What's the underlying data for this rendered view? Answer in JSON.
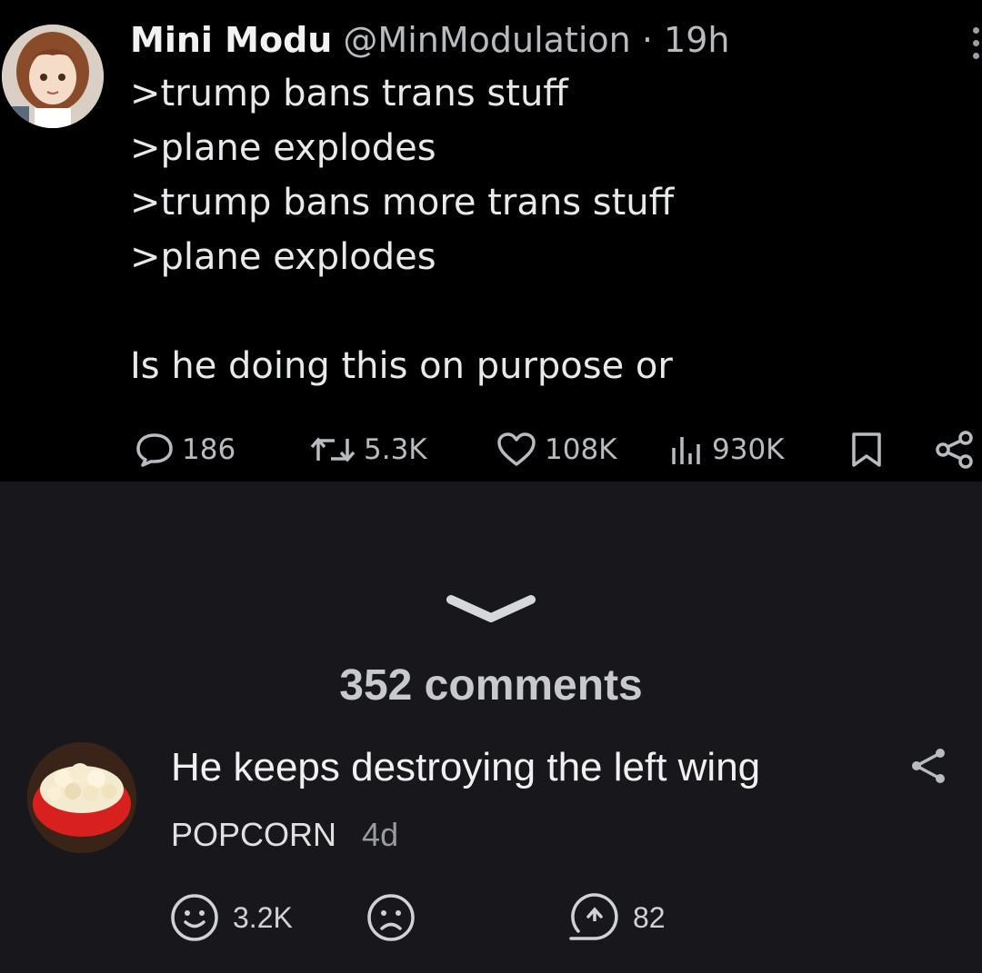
{
  "tweet": {
    "author_name": "Mini Modu",
    "handle": "@MinModulation",
    "separator": "·",
    "time": "19h",
    "lines": [
      ">trump bans trans stuff",
      ">plane explodes",
      ">trump bans more trans stuff",
      ">plane explodes",
      "Is he doing this on purpose or"
    ],
    "stats": {
      "replies": "186",
      "retweets": "5.3K",
      "likes": "108K",
      "views": "930K"
    }
  },
  "comments_header": "352 comments",
  "comment": {
    "text": "He keeps destroying the left wing",
    "username": "POPCORN",
    "age": "4d",
    "likes": "3.2K",
    "replies": "82"
  },
  "icons": {
    "reply": "reply-bubble-icon",
    "retweet": "retweet-icon",
    "like": "heart-icon",
    "views": "views-chart-icon",
    "bookmark": "bookmark-icon",
    "share": "share-icon",
    "more": "more-vertical-icon",
    "expand": "chevron-down-icon",
    "upvote": "smile-face-icon",
    "downvote": "frown-face-icon",
    "reply_comment": "reply-arrow-icon"
  },
  "colors": {
    "tweet_bg": "#000000",
    "page_bg": "#18181c",
    "text_primary": "#e7e9ea",
    "text_secondary": "#b8bcc0"
  }
}
